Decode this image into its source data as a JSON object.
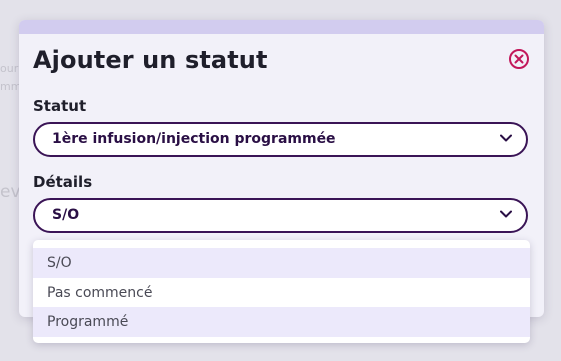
{
  "background": {
    "lines": [
      "our",
      "mm",
      "evi"
    ]
  },
  "modal": {
    "title": "Ajouter un statut",
    "close_icon": "close-circle-icon",
    "accent_color": "#c2185b",
    "border_color": "#3a1456"
  },
  "fields": {
    "statut": {
      "label": "Statut",
      "value": "1ère infusion/injection programmée"
    },
    "details": {
      "label": "Détails",
      "value": "S/O"
    }
  },
  "dropdown": {
    "options": [
      "S/O",
      "Pas commencé",
      "Programmé"
    ],
    "highlighted": [
      "S/O",
      "Programmé"
    ]
  }
}
